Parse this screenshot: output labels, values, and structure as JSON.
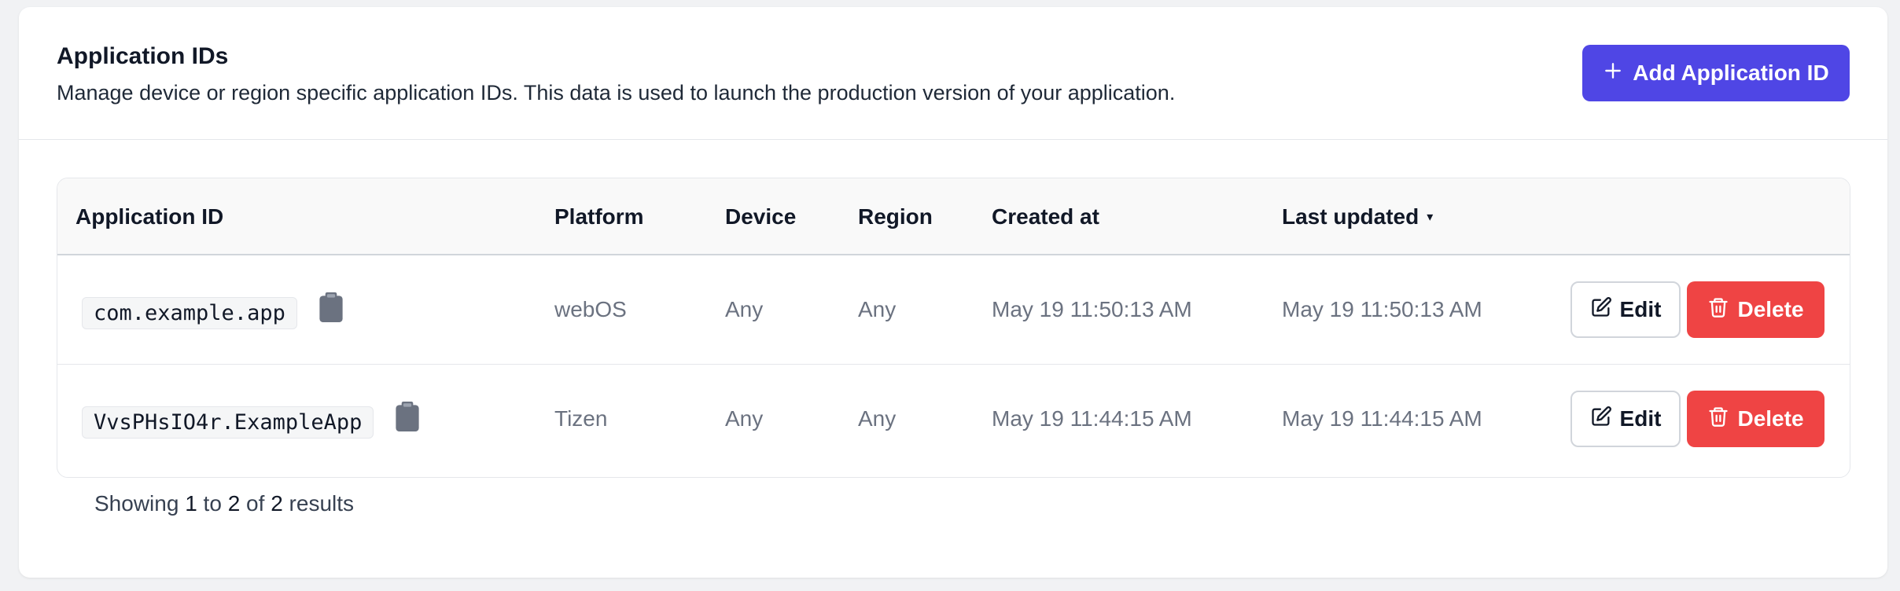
{
  "header": {
    "title": "Application IDs",
    "description": "Manage device or region specific application IDs. This data is used to launch the production version of your application.",
    "add_button_label": "Add Application ID"
  },
  "table": {
    "columns": {
      "application_id": "Application ID",
      "platform": "Platform",
      "device": "Device",
      "region": "Region",
      "created_at": "Created at",
      "last_updated": "Last updated"
    },
    "sort_indicator": "▾",
    "rows": [
      {
        "application_id": "com.example.app",
        "platform": "webOS",
        "device": "Any",
        "region": "Any",
        "created_at": "May 19 11:50:13 AM",
        "last_updated": "May 19 11:50:13 AM",
        "edit_label": "Edit",
        "delete_label": "Delete"
      },
      {
        "application_id": "VvsPHsIO4r.ExampleApp",
        "platform": "Tizen",
        "device": "Any",
        "region": "Any",
        "created_at": "May 19 11:44:15 AM",
        "last_updated": "May 19 11:44:15 AM",
        "edit_label": "Edit",
        "delete_label": "Delete"
      }
    ]
  },
  "pagination": {
    "prefix": "Showing",
    "from": "1",
    "to_word": "to",
    "to": "2",
    "of_word": "of",
    "total": "2",
    "suffix": "results"
  },
  "colors": {
    "primary": "#4f46e5",
    "danger": "#ef4444",
    "page_bg": "#f1f2f4",
    "muted_text": "#6b7280"
  },
  "icons": {
    "add": "plus-icon",
    "copy": "clipboard-icon",
    "edit": "pencil-square-icon",
    "delete": "trash-icon"
  }
}
